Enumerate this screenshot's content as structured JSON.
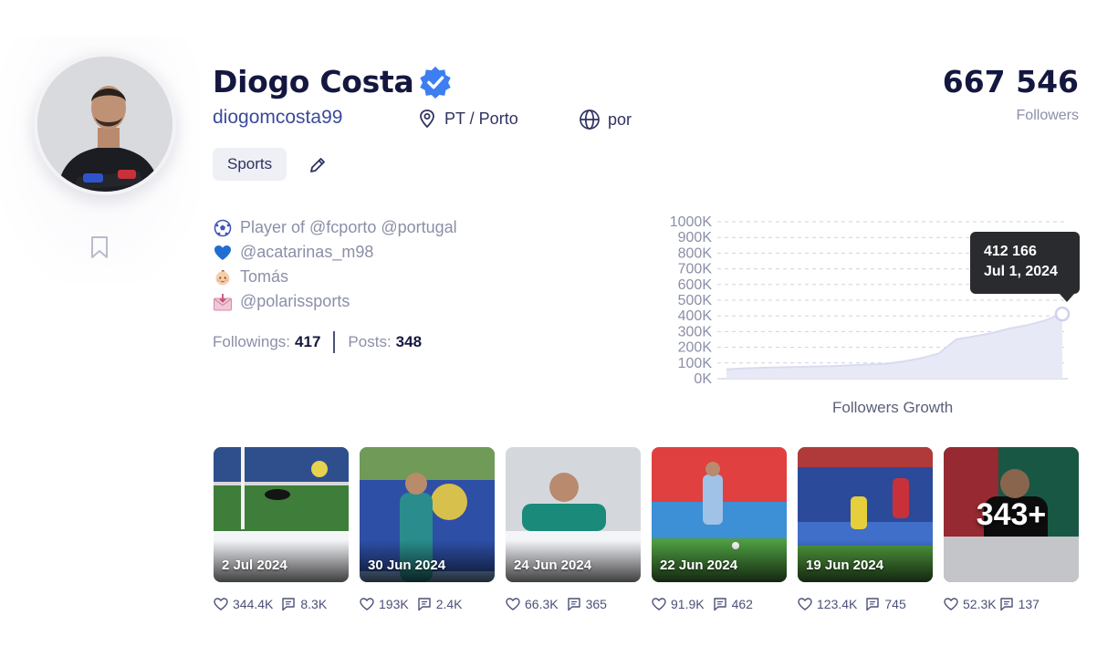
{
  "profile": {
    "name": "Diogo Costa",
    "handle": "diogomcosta99",
    "location": "PT / Porto",
    "language": "por",
    "category": "Sports",
    "followers_count": "667 546",
    "followers_label": "Followers",
    "bio": [
      {
        "icon": "soccer-ball-icon",
        "text": "Player of @fcporto @portugal"
      },
      {
        "icon": "blue-heart-icon",
        "text": "@acatarinas_m98"
      },
      {
        "icon": "baby-icon",
        "text": "Tomás"
      },
      {
        "icon": "envelope-icon",
        "text": "@polarissports"
      }
    ],
    "followings_label": "Followings:",
    "followings": "417",
    "posts_label": "Posts:",
    "posts": "348"
  },
  "chart_data": {
    "type": "area",
    "title": "Followers Growth",
    "y_ticks": [
      "1000K",
      "900K",
      "800K",
      "700K",
      "600K",
      "500K",
      "400K",
      "300K",
      "200K",
      "100K",
      "0K"
    ],
    "ylim": [
      0,
      1000000
    ],
    "grid": true,
    "series": [
      {
        "values": [
          60000,
          65000,
          70000,
          72000,
          75000,
          78000,
          80000,
          85000,
          90000,
          95000,
          110000,
          130000,
          160000,
          250000,
          270000,
          290000,
          320000,
          340000,
          370000,
          412166
        ]
      }
    ],
    "tooltip": {
      "value": "412 166",
      "date": "Jul 1, 2024"
    },
    "colors": {
      "fill": "#e8e9f7",
      "line": "#d9dbf0",
      "grid": "#d0d2dc",
      "tooltip_bg": "#2a2b2e"
    }
  },
  "posts": [
    {
      "date": "2 Jul 2024",
      "likes": "344.4K",
      "comments": "8.3K"
    },
    {
      "date": "30 Jun 2024",
      "likes": "193K",
      "comments": "2.4K"
    },
    {
      "date": "24 Jun 2024",
      "likes": "66.3K",
      "comments": "365"
    },
    {
      "date": "22 Jun 2024",
      "likes": "91.9K",
      "comments": "462"
    },
    {
      "date": "19 Jun 2024",
      "likes": "123.4K",
      "comments": "745"
    },
    {
      "more": "343+",
      "likes": "52.3K",
      "comments": "137"
    }
  ],
  "colors": {
    "brand_dark": "#14173f",
    "verified": "#3d7ff0",
    "muted": "#8b8fa8",
    "handle": "#3c4a9a"
  }
}
